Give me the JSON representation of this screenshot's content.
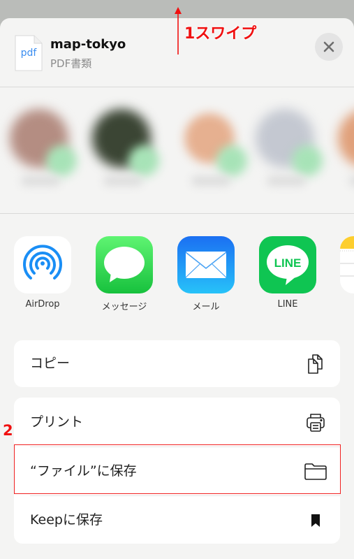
{
  "header": {
    "file_icon_ext": "pdf",
    "file_name": "map-tokyo",
    "file_type": "PDF書類",
    "close_icon": "close-icon"
  },
  "contacts": [
    {
      "avatar_color": "#b48d82"
    },
    {
      "avatar_color": "#3b4534"
    },
    {
      "avatar_color": "#d9a07e"
    },
    {
      "avatar_color": "#c4c8d1"
    },
    {
      "avatar_color": "#e0a07a"
    }
  ],
  "apps": [
    {
      "label": "AirDrop",
      "icon": "airdrop-icon"
    },
    {
      "label": "メッセージ",
      "icon": "messages-icon"
    },
    {
      "label": "メール",
      "icon": "mail-icon"
    },
    {
      "label": "LINE",
      "icon": "line-icon",
      "icon_text": "LINE"
    },
    {
      "label": "",
      "icon": "notes-icon"
    }
  ],
  "actions": {
    "group1": [
      {
        "label": "コピー",
        "icon": "copy-icon"
      }
    ],
    "group2": [
      {
        "label": "プリント",
        "icon": "printer-icon"
      },
      {
        "label": "“ファイル”に保存",
        "icon": "folder-icon"
      },
      {
        "label": "Keepに保存",
        "icon": "bookmark-icon"
      }
    ]
  },
  "annotations": {
    "step1": "1スワイプ",
    "step2": "2",
    "color": "#f01010"
  }
}
